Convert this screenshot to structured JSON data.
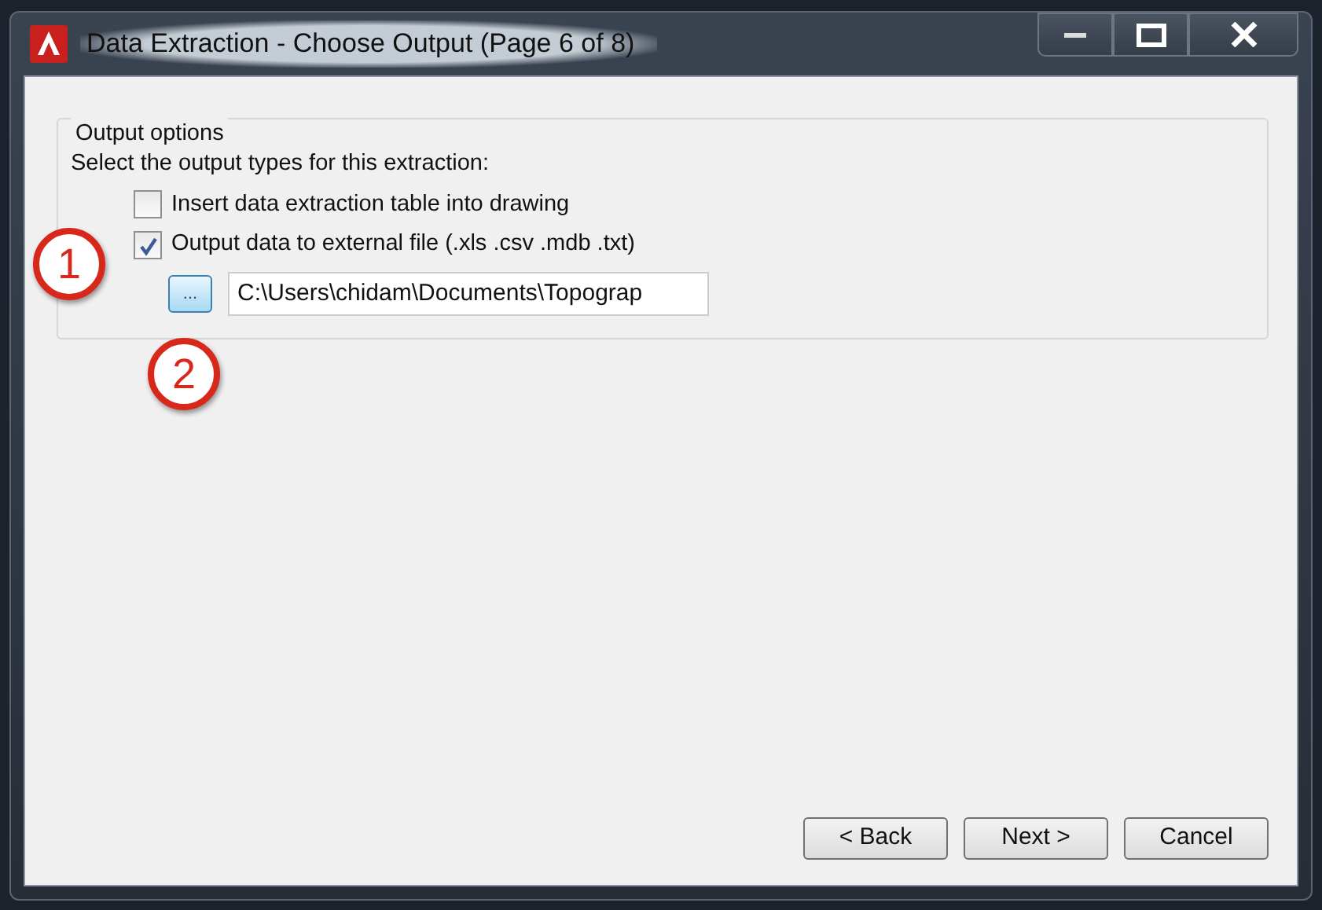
{
  "window": {
    "title": "Data Extraction - Choose Output (Page 6 of 8)"
  },
  "group": {
    "title": "Output options",
    "instruction": "Select the output types for this extraction:",
    "options": [
      {
        "label": "Insert data extraction table into drawing",
        "checked": false
      },
      {
        "label": "Output data to external file (.xls .csv .mdb .txt)",
        "checked": true
      }
    ],
    "browse_button": "...",
    "file_path": "C:\\Users\\chidam\\Documents\\Topograp"
  },
  "buttons": [
    "< Back",
    "Next >",
    "Cancel"
  ],
  "callouts": [
    {
      "label": "1"
    },
    {
      "label": "2"
    }
  ]
}
